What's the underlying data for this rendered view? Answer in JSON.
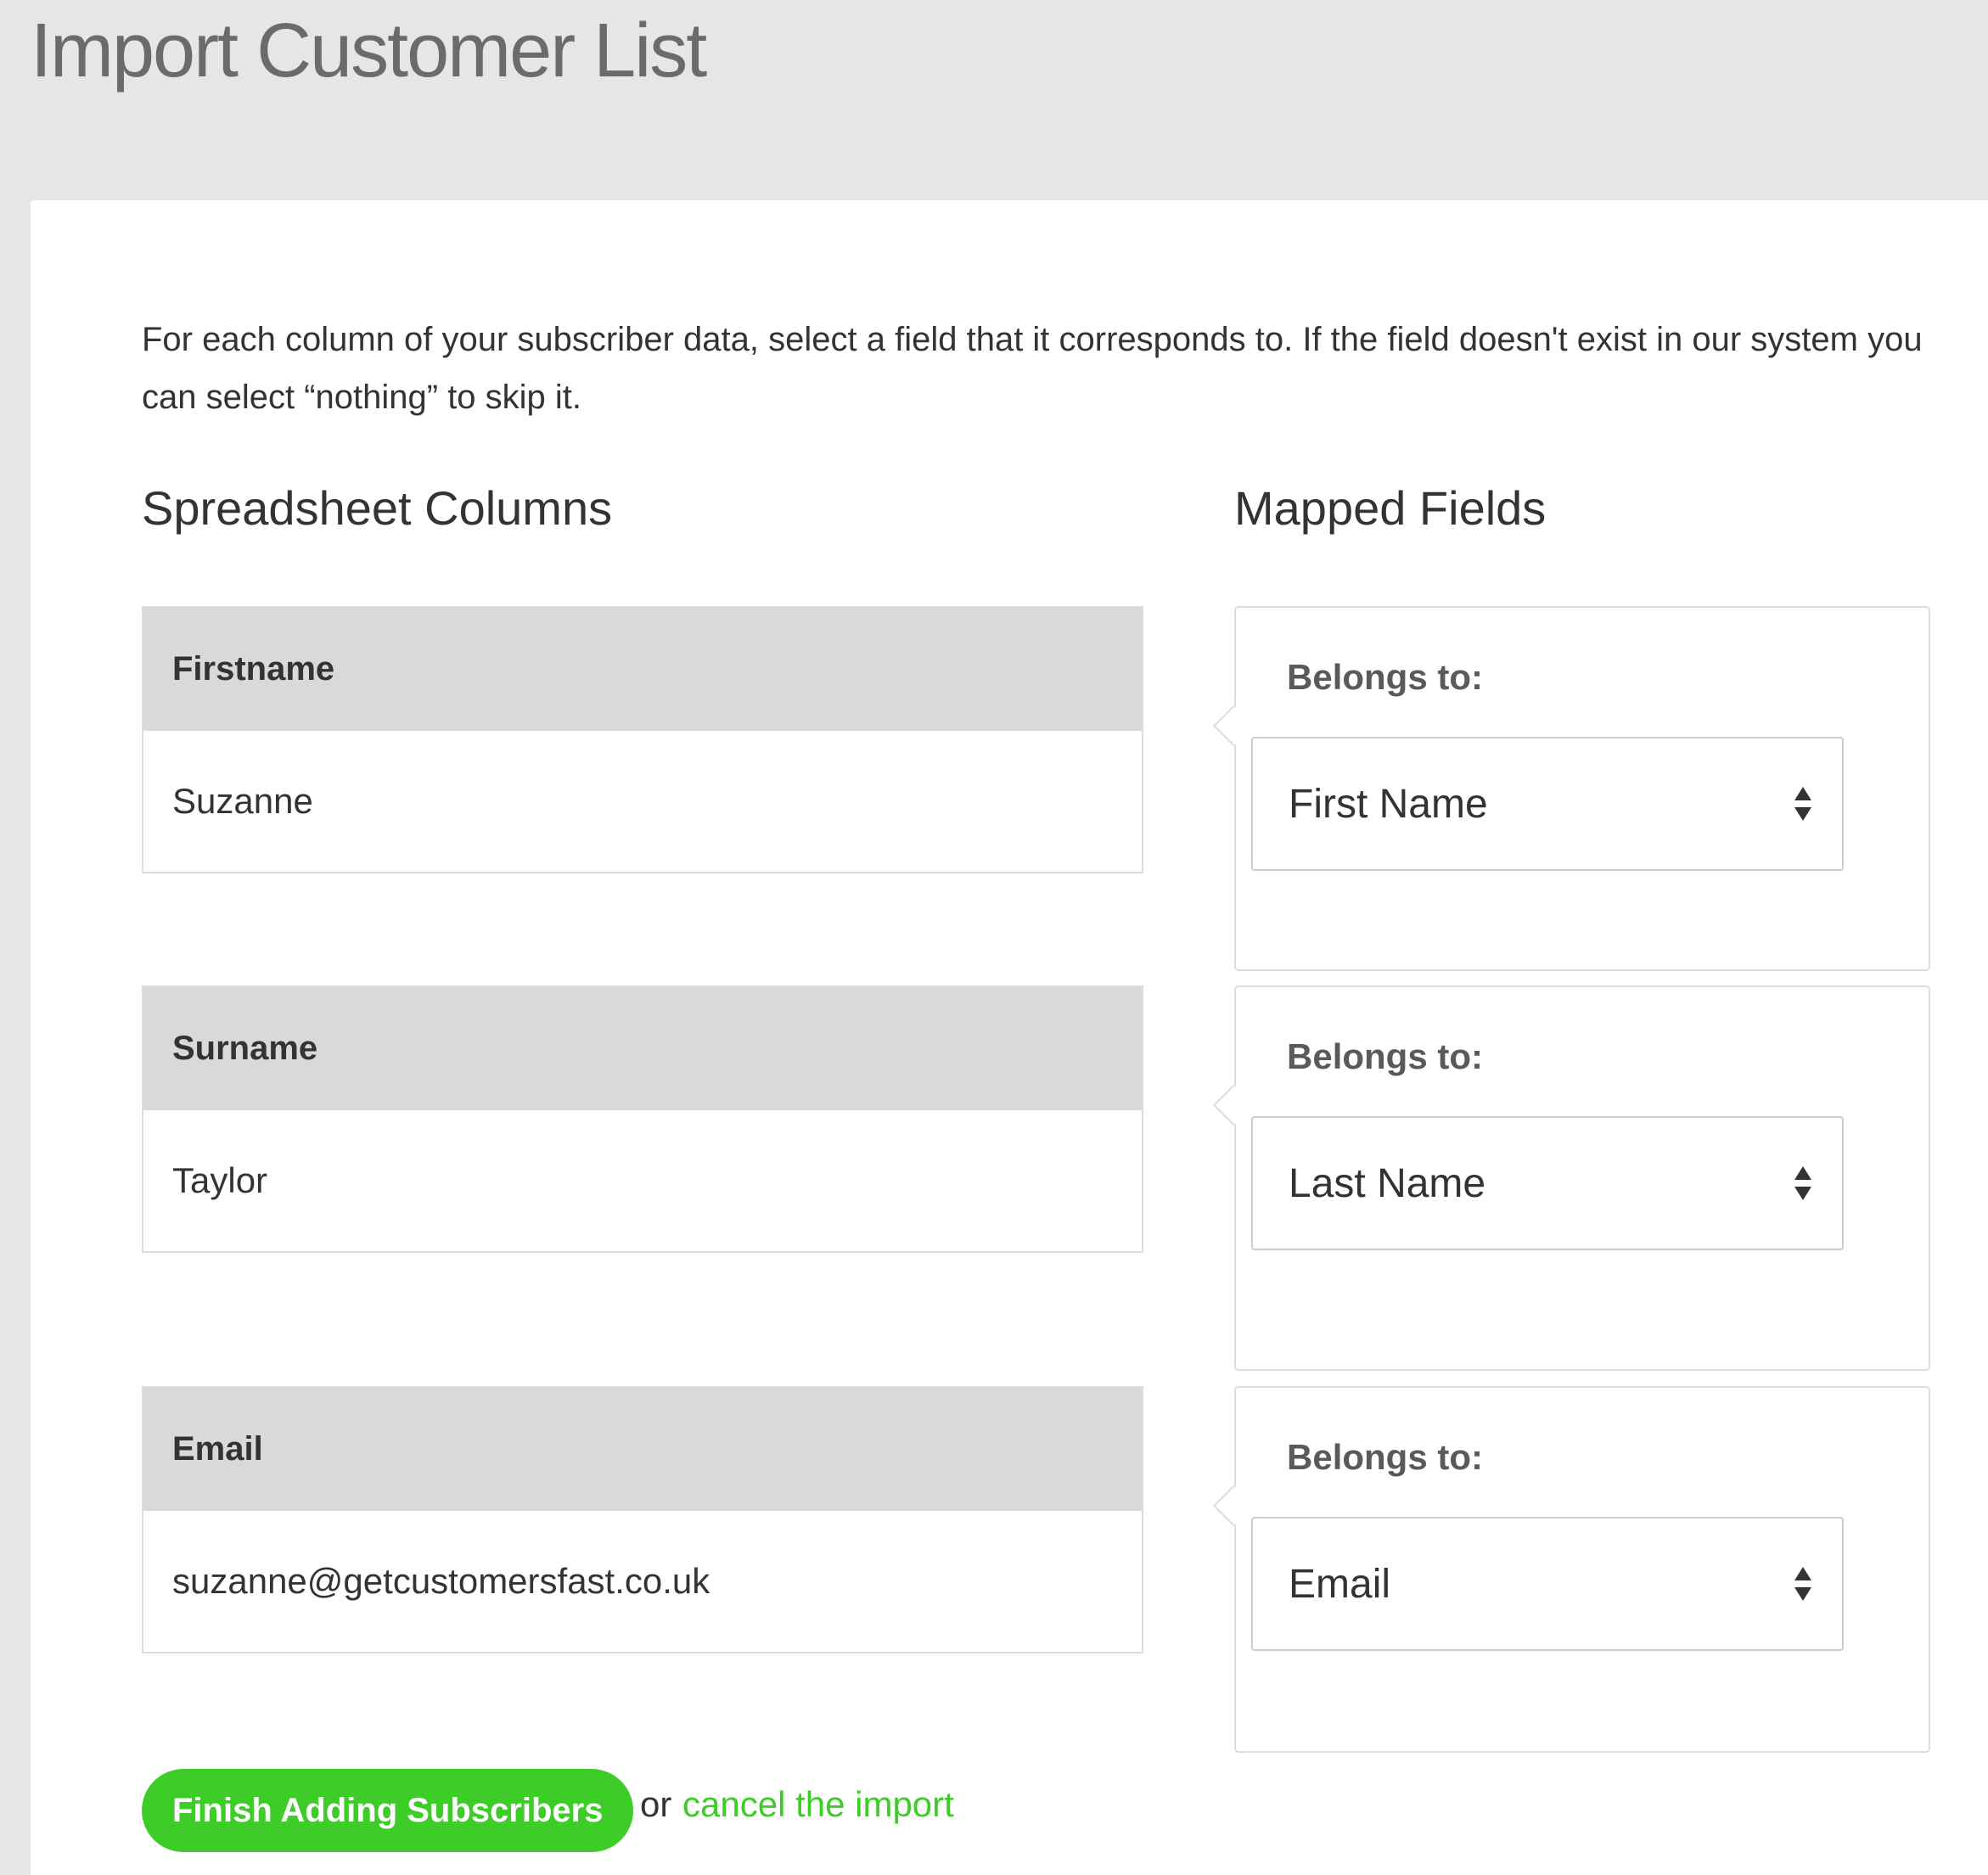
{
  "page": {
    "title": "Import Customer List"
  },
  "intro": {
    "text": "For each column of your subscriber data, select a field that it corresponds to.  If the field doesn't exist in our system you can select “nothing” to skip it."
  },
  "headings": {
    "spreadsheet_columns": "Spreadsheet Columns",
    "mapped_fields": "Mapped Fields"
  },
  "columns": [
    {
      "header": "Firstname",
      "value": "Suzanne"
    },
    {
      "header": "Surname",
      "value": "Taylor"
    },
    {
      "header": "Email",
      "value": "suzanne@getcustomersfast.co.uk"
    }
  ],
  "mappings": [
    {
      "label": "Belongs to:",
      "selected": "First Name",
      "icon": "select-arrows-icon"
    },
    {
      "label": "Belongs to:",
      "selected": "Last Name",
      "icon": "select-arrows-icon"
    },
    {
      "label": "Belongs to:",
      "selected": "Email",
      "icon": "select-arrows-icon"
    }
  ],
  "actions": {
    "finish_label": "Finish Adding Subscribers",
    "or_text": "or",
    "cancel_label": "cancel the import"
  },
  "colors": {
    "accent": "#3dcc28",
    "header_bg": "#d9d9d9",
    "page_bg": "#e6e6e6"
  }
}
